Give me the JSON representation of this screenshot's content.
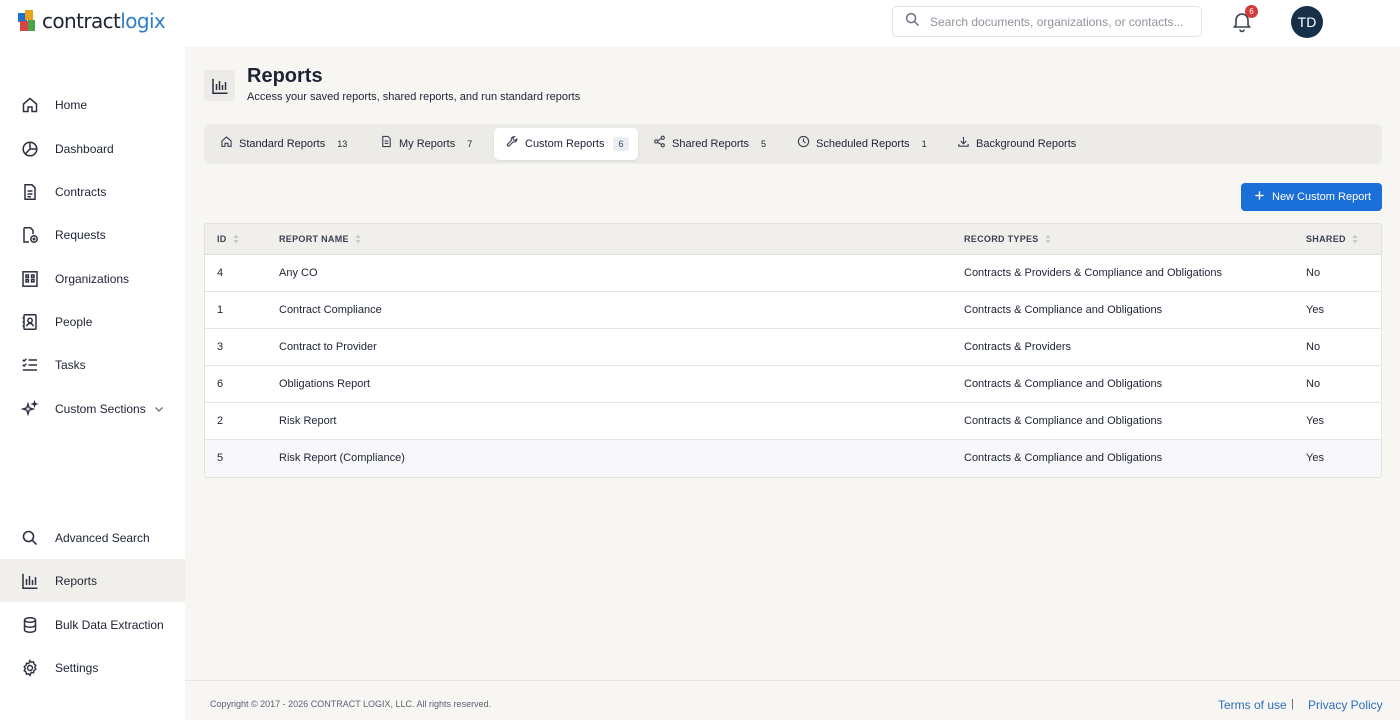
{
  "brand": {
    "logo_text_main": "contract",
    "logo_text_accent": "logix"
  },
  "search": {
    "placeholder": "Search documents, organizations, or contacts..."
  },
  "notifications": {
    "count": "6"
  },
  "user": {
    "initials": "TD"
  },
  "sidebar": {
    "items": [
      {
        "label": "Home",
        "icon": "home-icon"
      },
      {
        "label": "Dashboard",
        "icon": "dashboard-icon"
      },
      {
        "label": "Contracts",
        "icon": "document-icon"
      },
      {
        "label": "Requests",
        "icon": "request-icon"
      },
      {
        "label": "Organizations",
        "icon": "building-icon"
      },
      {
        "label": "People",
        "icon": "contact-icon"
      },
      {
        "label": "Tasks",
        "icon": "tasks-icon"
      },
      {
        "label": "Custom Sections",
        "icon": "sparkle-icon"
      }
    ],
    "bottom_items": [
      {
        "label": "Advanced Search",
        "icon": "search-icon"
      },
      {
        "label": "Reports",
        "icon": "bar-chart-icon",
        "active": true
      },
      {
        "label": "Bulk Data Extraction",
        "icon": "database-icon"
      },
      {
        "label": "Settings",
        "icon": "gear-icon"
      }
    ]
  },
  "header": {
    "title": "Reports",
    "subtitle": "Access your saved reports, shared reports, and run standard reports"
  },
  "tabs": [
    {
      "label": "Standard Reports",
      "count": "13",
      "icon": "home-icon"
    },
    {
      "label": "My Reports",
      "count": "7",
      "icon": "document-icon"
    },
    {
      "label": "Custom Reports",
      "count": "6",
      "icon": "wrench-icon",
      "active": true
    },
    {
      "label": "Shared Reports",
      "count": "5",
      "icon": "share-icon"
    },
    {
      "label": "Scheduled Reports",
      "count": "1",
      "icon": "clock-icon"
    },
    {
      "label": "Background Reports",
      "count": "",
      "icon": "download-icon"
    }
  ],
  "actions": {
    "new_custom_report": "New Custom Report"
  },
  "table": {
    "columns": [
      "ID",
      "REPORT NAME",
      "RECORD TYPES",
      "SHARED"
    ],
    "rows": [
      {
        "id": "4",
        "name": "Any CO",
        "record_types": "Contracts & Providers & Compliance and Obligations",
        "shared": "No"
      },
      {
        "id": "1",
        "name": "Contract Compliance",
        "record_types": "Contracts & Compliance and Obligations",
        "shared": "Yes"
      },
      {
        "id": "3",
        "name": "Contract to Provider",
        "record_types": "Contracts & Providers",
        "shared": "No"
      },
      {
        "id": "6",
        "name": "Obligations Report",
        "record_types": "Contracts & Compliance and Obligations",
        "shared": "No"
      },
      {
        "id": "2",
        "name": "Risk Report",
        "record_types": "Contracts & Compliance and Obligations",
        "shared": "Yes"
      },
      {
        "id": "5",
        "name": "Risk Report (Compliance)",
        "record_types": "Contracts & Compliance and Obligations",
        "shared": "Yes"
      }
    ]
  },
  "footer": {
    "copyright": "Copyright © 2017 - 2026 CONTRACT LOGIX, LLC. All rights reserved.",
    "terms": "Terms of use",
    "separator": "|",
    "privacy": "Privacy Policy"
  },
  "colors": {
    "primary_button": "#1b6fd8",
    "link": "#2b6fb8",
    "badge": "#d23b3b",
    "avatar": "#17304a",
    "page_bg": "#f7f6f3"
  }
}
